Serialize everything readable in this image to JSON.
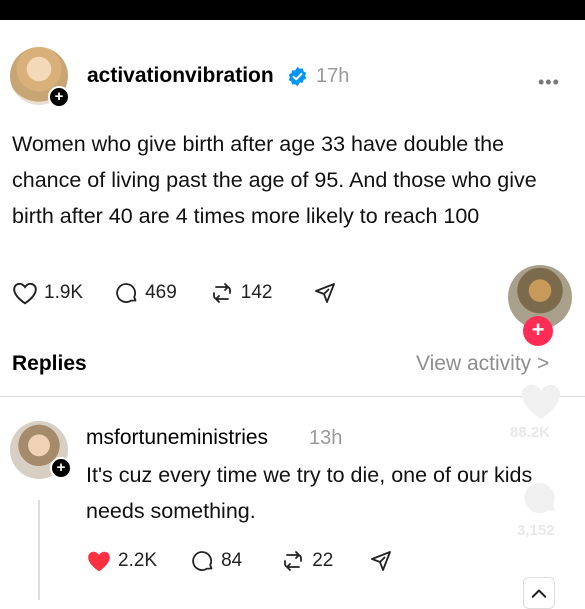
{
  "post": {
    "username": "activationvibration",
    "time": "17h",
    "text": "Women who give birth after age 33 have double the chance of living past the age of 95. And those who give birth after 40 are 4 times more likely to reach 100",
    "likes": "1.9K",
    "comments": "469",
    "reposts": "142"
  },
  "replies_header": {
    "label": "Replies",
    "view_activity": "View activity"
  },
  "reply": {
    "username": "msfortuneministries",
    "time": "13h",
    "text": "It's cuz every time we try to die, one of our kids needs something.",
    "likes": "2.2K",
    "comments": "84",
    "reposts": "22"
  },
  "overlay": {
    "like_count": "88.2K",
    "comment_count": "3,152"
  },
  "colors": {
    "verified": "#0095f6",
    "liked_heart": "#ff3040",
    "follow_plus": "#ff2d55"
  },
  "icons": [
    "plus-icon",
    "verified-icon",
    "more-icon",
    "heart-icon",
    "comment-icon",
    "repost-icon",
    "share-icon",
    "chevron-right-icon"
  ]
}
